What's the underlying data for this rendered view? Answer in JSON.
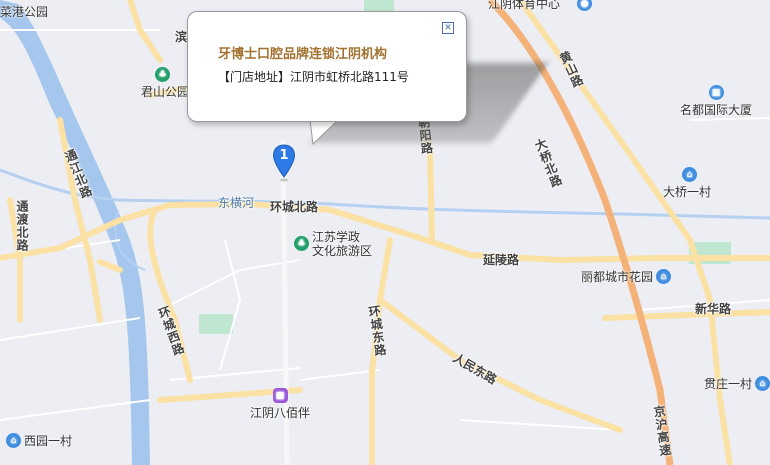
{
  "popup": {
    "title": "牙博士口腔品牌连锁江阴机构",
    "address": "【门店地址】江阴市虹桥北路111号",
    "close_icon": "close-icon"
  },
  "marker": {
    "number": "1"
  },
  "roads": {
    "huancheng_north": "环城北路",
    "yanling": "延陵路",
    "huancheng_east": "环城东路",
    "huancheng_west": "环城西路",
    "tongjiang_north": "通江北路",
    "tongdu_north": "通渡北路",
    "chaoyang": "朝阳路",
    "huangshan": "黄山路",
    "daqiao_north": "大桥北路",
    "renmin_east": "人民东路",
    "xinhua": "新华路",
    "jinghu": "京沪高速",
    "bin": "滨"
  },
  "water": {
    "dongheng": "东横河"
  },
  "pois": {
    "nancai_port": "菜港公园",
    "junshan_park": "君山公园",
    "sports_center": "江阴体育中心",
    "mingdu": "名都国际大厦",
    "daqiao_village": "大桥一村",
    "jiangsu_xuezheng": "江苏学政\n文化旅游区",
    "lidu_garden": "丽都城市花园",
    "guiting_village": "贯庄一村",
    "babai_ban": "江阴八佰伴",
    "xiyuan_village": "西园一村"
  }
}
